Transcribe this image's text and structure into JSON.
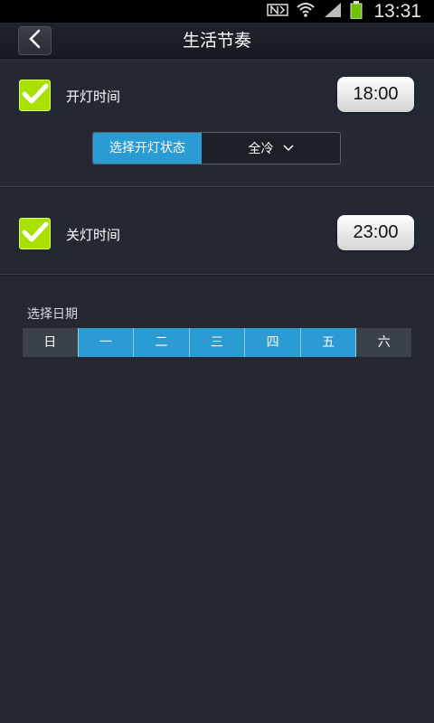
{
  "status_bar": {
    "time": "13:31",
    "icons": [
      "nfc-icon",
      "wifi-icon",
      "signal-icon",
      "battery-icon"
    ]
  },
  "header": {
    "title": "生活节奏",
    "back_icon": "back-arrow-icon"
  },
  "light_on": {
    "checked": true,
    "label": "开灯时间",
    "time": "18:00",
    "state_label": "选择开灯状态",
    "state_value": "全冷"
  },
  "light_off": {
    "checked": true,
    "label": "关灯时间",
    "time": "23:00"
  },
  "date_picker": {
    "caption": "选择日期",
    "days": [
      {
        "label": "日",
        "selected": false
      },
      {
        "label": "一",
        "selected": true
      },
      {
        "label": "二",
        "selected": true
      },
      {
        "label": "三",
        "selected": true
      },
      {
        "label": "四",
        "selected": true
      },
      {
        "label": "五",
        "selected": true
      },
      {
        "label": "六",
        "selected": false
      }
    ]
  },
  "colors": {
    "background": "#232832",
    "accent": "#2b9bd3",
    "checkbox": "#a9e000"
  }
}
